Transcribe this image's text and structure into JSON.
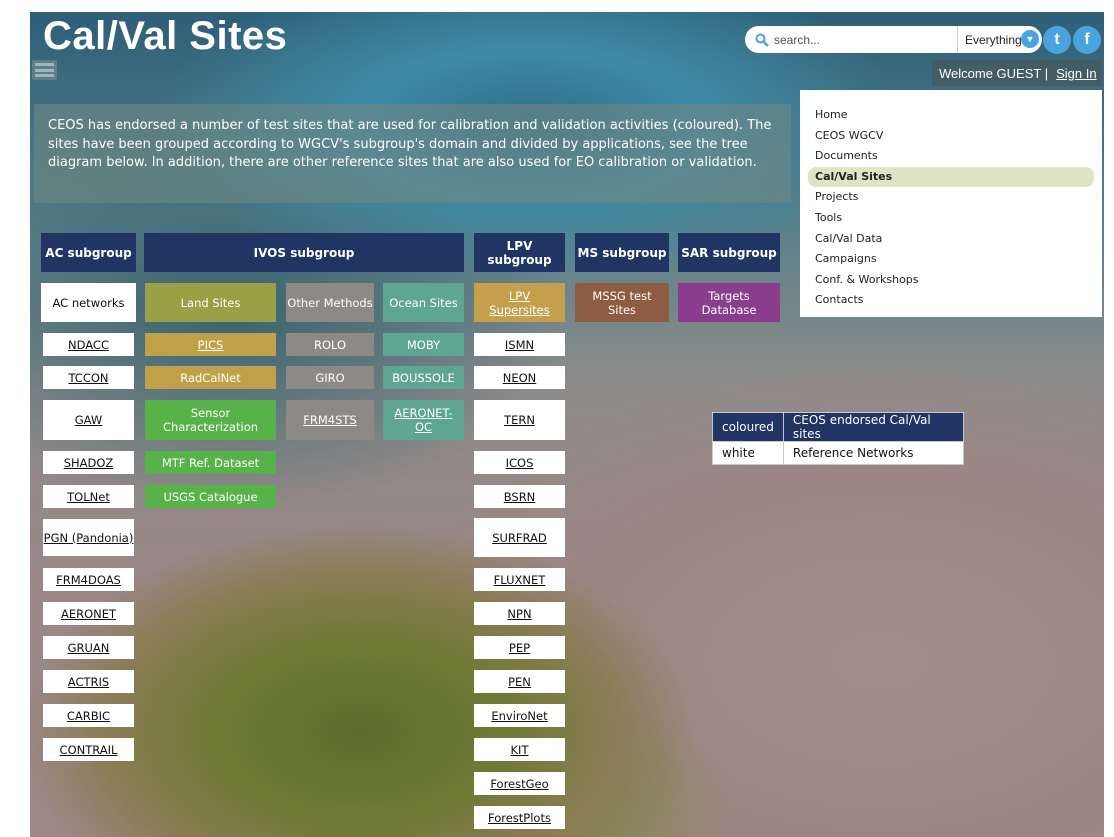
{
  "header": {
    "title": "Cal/Val Sites",
    "search_placeholder": "search...",
    "scope": "Everything",
    "welcome": "Welcome GUEST |",
    "sign_in": "Sign In"
  },
  "nav": {
    "items": [
      "Home",
      "CEOS WGCV",
      "Documents",
      "Cal/Val Sites",
      "Projects",
      "Tools",
      "Cal/Val Data",
      "Campaigns",
      "Conf. & Workshops",
      "Contacts"
    ],
    "active": "Cal/Val Sites"
  },
  "intro": "CEOS has endorsed a number of test sites that are used for calibration and validation activities (coloured). The sites have been grouped according to WGCV's subgroup's domain and divided by applications, see the tree diagram below. In addition, there are other reference sites that are also used for EO calibration or validation.",
  "headers": {
    "ac": "AC subgroup",
    "ivos": "IVOS subgroup",
    "lpv": "LPV subgroup",
    "ms": "MS subgroup",
    "sar": "SAR subgroup"
  },
  "ac": {
    "networks_label": "AC networks",
    "items": [
      "NDACC",
      "TCCON",
      "GAW",
      "SHADOZ",
      "TOLNet",
      "PGN (Pandonia)",
      "FRM4DOAS",
      "AERONET",
      "GRUAN",
      "ACTRIS",
      "CARBIC",
      "CONTRAIL"
    ]
  },
  "ivos": {
    "land_sites": "Land Sites",
    "other_methods": "Other Methods",
    "ocean_sites": "Ocean Sites",
    "pics": "PICS",
    "radcalnet": "RadCalNet",
    "sensor_char": "Sensor Characterization",
    "mtf": "MTF Ref. Dataset",
    "usgs": "USGS Catalogue",
    "rolo": "ROLO",
    "giro": "GIRO",
    "frm4sts": "FRM4STS",
    "moby": "MOBY",
    "boussole": "BOUSSOLE",
    "aeronet_oc": "AERONET-OC"
  },
  "lpv": {
    "supersites": "LPV Supersites",
    "items": [
      "ISMN",
      "NEON",
      "TERN",
      "ICOS",
      "BSRN",
      "SURFRAD",
      "FLUXNET",
      "NPN",
      "PEP",
      "PEN",
      "EnviroNet",
      "KIT",
      "ForestGeo",
      "ForestPlots"
    ]
  },
  "ms": {
    "test_sites": "MSSG test Sites"
  },
  "sar": {
    "targets": "Targets Database"
  },
  "legend": {
    "coloured": "coloured",
    "coloured_desc": "CEOS endorsed Cal/Val sites",
    "white": "white",
    "white_desc": "Reference Networks"
  },
  "colors": {
    "header_navy": "#203563",
    "gold": "#c1a04a",
    "olive": "#98a146",
    "gray": "#8d8a86",
    "teal": "#5ea691",
    "green": "#58b24a",
    "brown": "#8e5b43",
    "purple": "#8a3d8c"
  }
}
